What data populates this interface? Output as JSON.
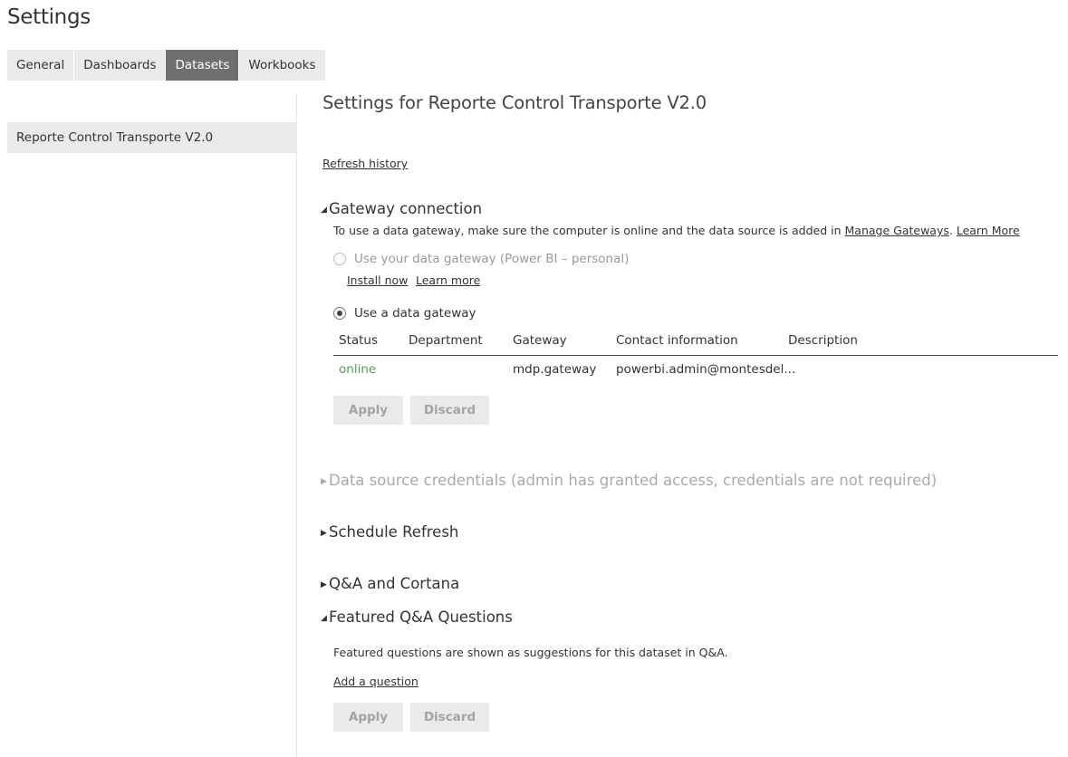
{
  "page": {
    "title": "Settings"
  },
  "tabs": [
    {
      "label": "General",
      "active": false
    },
    {
      "label": "Dashboards",
      "active": false
    },
    {
      "label": "Datasets",
      "active": true
    },
    {
      "label": "Workbooks",
      "active": false
    }
  ],
  "sidebar": {
    "datasets": [
      {
        "label": "Reporte Control Transporte V2.0",
        "selected": true
      }
    ]
  },
  "main": {
    "title": "Settings for Reporte Control Transporte V2.0",
    "refresh_history": "Refresh history",
    "gateway": {
      "heading": "Gateway connection",
      "expanded": true,
      "desc_prefix": "To use a data gateway, make sure the computer is online and the data source is added in ",
      "manage_gateways": "Manage Gateways",
      "desc_sep": ". ",
      "learn_more": "Learn More",
      "personal_option": "Use your data gateway (Power BI – personal)",
      "install_now": "Install now",
      "learn_more_personal": "Learn more",
      "gateway_option": "Use a data gateway",
      "table": {
        "headers": [
          "Status",
          "Department",
          "Gateway",
          "Contact information",
          "Description"
        ],
        "row": {
          "status": "online",
          "department": "",
          "gateway": "mdp.gateway",
          "contact": "powerbi.admin@montesdel...",
          "description": ""
        }
      },
      "apply": "Apply",
      "discard": "Discard"
    },
    "credentials": {
      "heading": "Data source credentials (admin has granted access, credentials are not required)",
      "expanded": false
    },
    "schedule": {
      "heading": "Schedule Refresh",
      "expanded": false
    },
    "qna": {
      "heading": "Q&A and Cortana",
      "expanded": false
    },
    "featured": {
      "heading": "Featured Q&A Questions",
      "expanded": true,
      "description": "Featured questions are shown as suggestions for this dataset in Q&A.",
      "add_question": "Add a question",
      "apply": "Apply",
      "discard": "Discard"
    }
  },
  "icons": {
    "expanded": "triangle-expanded-icon",
    "collapsed": "triangle-collapsed-icon"
  },
  "colors": {
    "status_online": "#5b9a5b",
    "tab_active_bg": "#6f6f6f",
    "tab_bg": "#eaeaea",
    "disabled_text": "#a9a9a9"
  }
}
